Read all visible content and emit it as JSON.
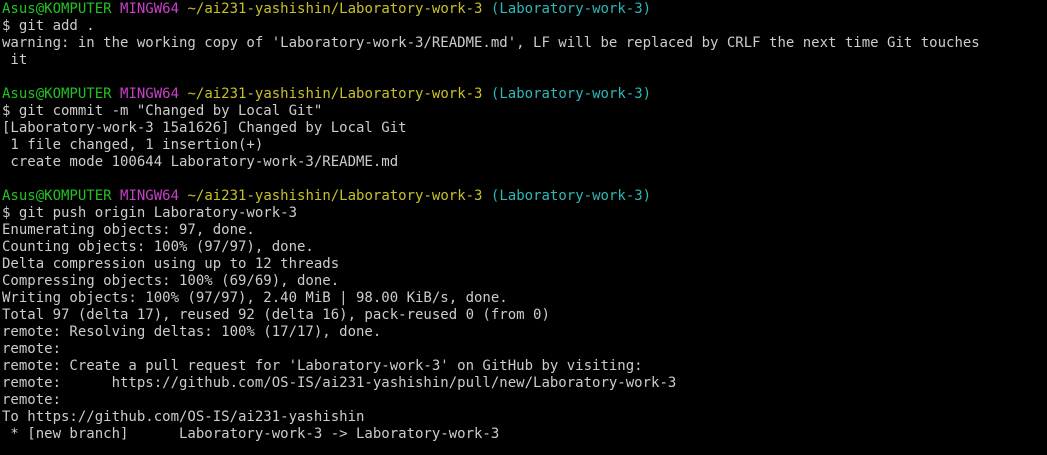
{
  "terminal": {
    "colors": {
      "background": "#000000",
      "text": "#cccccc",
      "user": "#23c223",
      "msystem": "#c740c7",
      "path": "#c8c127",
      "branch": "#2eb8b8"
    },
    "blocks": [
      {
        "prompt": {
          "user": "Asus@KOMPUTER",
          "msystem": "MINGW64",
          "path": "~/ai231-yashishin/Laboratory-work-3",
          "branch": "(Laboratory-work-3)"
        },
        "command": "$ git add .",
        "output": [
          "warning: in the working copy of 'Laboratory-work-3/README.md', LF will be replaced by CRLF the next time Git touches",
          " it"
        ]
      },
      {
        "prompt": {
          "user": "Asus@KOMPUTER",
          "msystem": "MINGW64",
          "path": "~/ai231-yashishin/Laboratory-work-3",
          "branch": "(Laboratory-work-3)"
        },
        "command": "$ git commit -m \"Changed by Local Git\"",
        "output": [
          "[Laboratory-work-3 15a1626] Changed by Local Git",
          " 1 file changed, 1 insertion(+)",
          " create mode 100644 Laboratory-work-3/README.md"
        ]
      },
      {
        "prompt": {
          "user": "Asus@KOMPUTER",
          "msystem": "MINGW64",
          "path": "~/ai231-yashishin/Laboratory-work-3",
          "branch": "(Laboratory-work-3)"
        },
        "command": "$ git push origin Laboratory-work-3",
        "output": [
          "Enumerating objects: 97, done.",
          "Counting objects: 100% (97/97), done.",
          "Delta compression using up to 12 threads",
          "Compressing objects: 100% (69/69), done.",
          "Writing objects: 100% (97/97), 2.40 MiB | 98.00 KiB/s, done.",
          "Total 97 (delta 17), reused 92 (delta 16), pack-reused 0 (from 0)",
          "remote: Resolving deltas: 100% (17/17), done.",
          "remote:",
          "remote: Create a pull request for 'Laboratory-work-3' on GitHub by visiting:",
          "remote:      https://github.com/OS-IS/ai231-yashishin/pull/new/Laboratory-work-3",
          "remote:",
          "To https://github.com/OS-IS/ai231-yashishin",
          " * [new branch]      Laboratory-work-3 -> Laboratory-work-3"
        ]
      }
    ]
  }
}
